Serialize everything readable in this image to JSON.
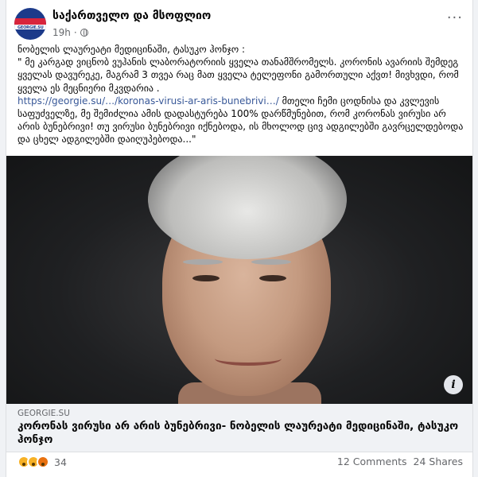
{
  "post": {
    "page_name": "საქართველო და მსოფლიო",
    "time": "19h",
    "more_icon": "ellipsis-icon",
    "audience_icon": "globe-icon",
    "avatar_text": "GEORGIE.SU",
    "body_line1": "ნობელის ლაურეატი მედიცინაში, ტასუკო ჰონჯო :",
    "body_line2": "\" მე კარგად ვიცნობ ვუჰანის ლაბორატორიის ყველა თანამშრომელს. კორონის ავარიის შემდეგ ყველას დავურეკე, მაგრამ 3 თვეა რაც მათ ყველა ტელეფონი გამორთული აქვთ! მივხვდი, რომ ყველა ეს მეცნიერი მკვდარია .",
    "body_link": "https://georgie.su/…/koronas-virusi-ar-aris-bunebrivi…/",
    "body_line3": " მთელი ჩემი ცოდნისა და კვლევის საფუძველზე, მე შემიძლია ამის დადასტურება 100% დარწმუნებით, რომ კორონას ვირუსი არ არის ბუნებრივი! თუ ვირუსი ბუნებრივი იქნებოდა, ის მხოლოდ ცივ ადგილებში გავრცელდებოდა და ცხელ ადგილებში დაიღუპებოდა...\"",
    "info_label": "i",
    "link_domain": "GEORGIE.SU",
    "link_title": "კორონას ვირუსი არ არის ბუნებრივი- ნობელის ლაურეატი მედიცინაში, ტასუკო ჰონჯო",
    "reaction_count": "34",
    "comments": "12 Comments",
    "shares": "24 Shares"
  }
}
